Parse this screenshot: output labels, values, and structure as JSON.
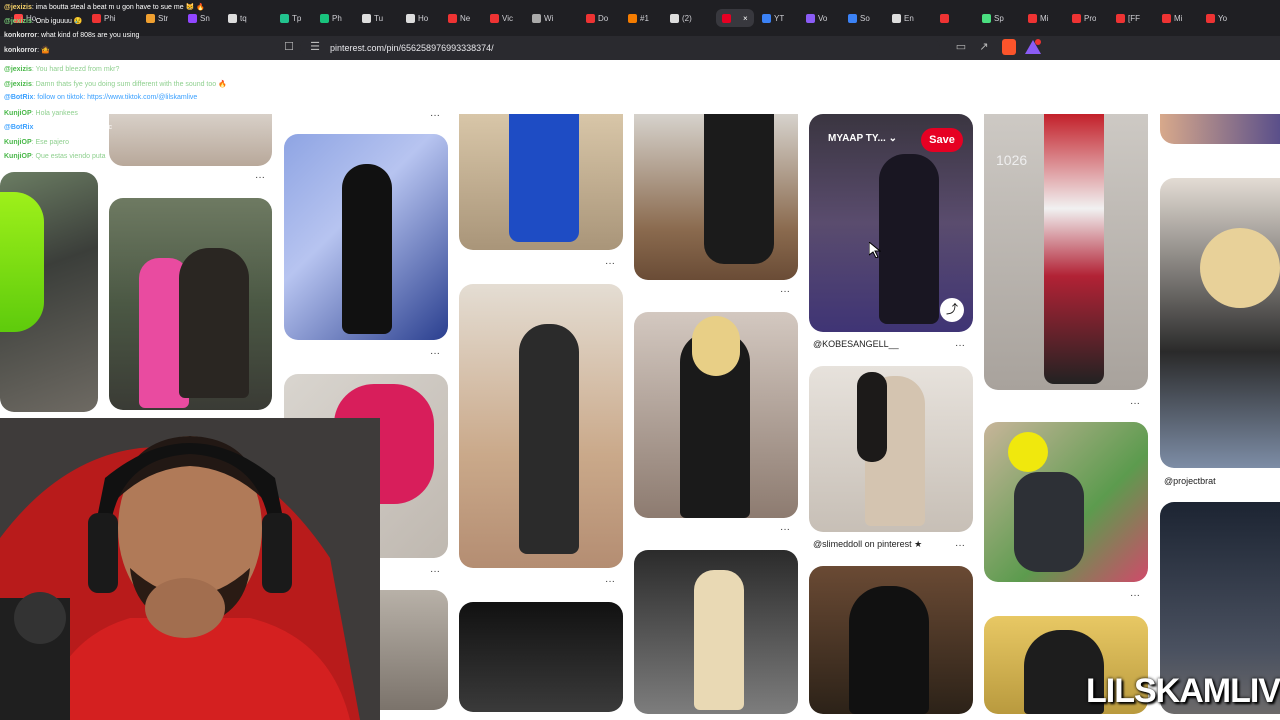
{
  "browser": {
    "tabs": [
      {
        "label": "Ho",
        "color": "#ff4444"
      },
      {
        "label": "Phi",
        "color": "#e33"
      },
      {
        "label": "Str",
        "color": "#f0a030"
      },
      {
        "label": "Sn",
        "color": "#9146ff"
      },
      {
        "label": "tq",
        "color": "#ddd"
      },
      {
        "label": "Tp",
        "color": "#22c38e"
      },
      {
        "label": "Ph",
        "color": "#19c37d"
      },
      {
        "label": "Tu",
        "color": "#ddd"
      },
      {
        "label": "Ho",
        "color": "#ddd"
      },
      {
        "label": "Ne",
        "color": "#e33"
      },
      {
        "label": "Vic",
        "color": "#e33"
      },
      {
        "label": "Wi",
        "color": "#aaa"
      },
      {
        "label": "Do",
        "color": "#e33"
      },
      {
        "label": "#1",
        "color": "#f57c00"
      },
      {
        "label": "(2)",
        "color": "#ddd"
      },
      {
        "label": "",
        "color": "#e60023"
      },
      {
        "label": "YT",
        "color": "#3b82f6"
      },
      {
        "label": "Vo",
        "color": "#8b5cf6"
      },
      {
        "label": "So",
        "color": "#3b82f6"
      },
      {
        "label": "En",
        "color": "#ddd"
      },
      {
        "label": "",
        "color": "#e33"
      },
      {
        "label": "Sp",
        "color": "#4ade80"
      },
      {
        "label": "Mi",
        "color": "#e33"
      },
      {
        "label": "Pro",
        "color": "#e33"
      },
      {
        "label": "[FF",
        "color": "#e33"
      },
      {
        "label": "Mi",
        "color": "#e33"
      },
      {
        "label": "Yo",
        "color": "#e33"
      }
    ],
    "active_tab_close": "×",
    "url": "pinterest.com/pin/656258976993338374/"
  },
  "chat": {
    "lines": [
      {
        "name": "@jexizis",
        "name_color": "#f7d26a",
        "text": ": ima boutta steal a beat m u gon have to sue me 😸 🔥",
        "text_color": "#ffffff"
      },
      {
        "name": "@jexizis",
        "name_color": "#7cd67c",
        "text": ": Onb iguuuu 😢",
        "text_color": "#ffffff"
      },
      {
        "name": "konkorror",
        "name_color": "#e6e6e6",
        "text": ": what kind of 808s are you using",
        "text_color": "#ffffff"
      },
      {
        "name": "konkorror",
        "name_color": "#e6e6e6",
        "text": ": 🤷",
        "text_color": "#ffffff"
      },
      {
        "name": "@jexizis",
        "name_color": "#49b849",
        "text": ": You hard bleezd from mkr?",
        "text_color": "#8fd08f"
      },
      {
        "name": "@jexizis",
        "name_color": "#49b849",
        "text": ": Damn thats fye you doing sum different with the sound too 🔥",
        "text_color": "#8fd08f"
      },
      {
        "name": "@BotRix",
        "name_color": "#3aa0ff",
        "text": ": follow on tiktok: https://www.tiktok.com/@lilskamlive",
        "text_color": "#3aa0ff"
      },
      {
        "name": "KunjiOP",
        "name_color": "#49b849",
        "text": ": Hola yankees",
        "text_color": "#8fd08f"
      },
      {
        "name": "@BotRix",
        "name_color": "#3aa0ff",
        "text": ": lilskamlive makes music",
        "text_color": "#ffffff"
      },
      {
        "name": "KunjiOP",
        "name_color": "#49b849",
        "text": ": Ese pajero",
        "text_color": "#8fd08f"
      },
      {
        "name": "KunjiOP",
        "name_color": "#49b849",
        "text": ": Que estas viendo puta",
        "text_color": "#8fd08f"
      }
    ]
  },
  "pins": {
    "hover": {
      "board_name": "MYAAP TY...",
      "board_chevron": "⌄",
      "save_label": "Save",
      "share_icon": "⤴"
    },
    "captions": {
      "kobe": "@KOBESANGELL__",
      "slimed": "@slimeddoll on pinterest ★",
      "project": "@projectbrat"
    },
    "overlay_text": "1026",
    "menu_glyph": "···"
  },
  "stream": {
    "watermark": "LILSKAMLIVE"
  }
}
